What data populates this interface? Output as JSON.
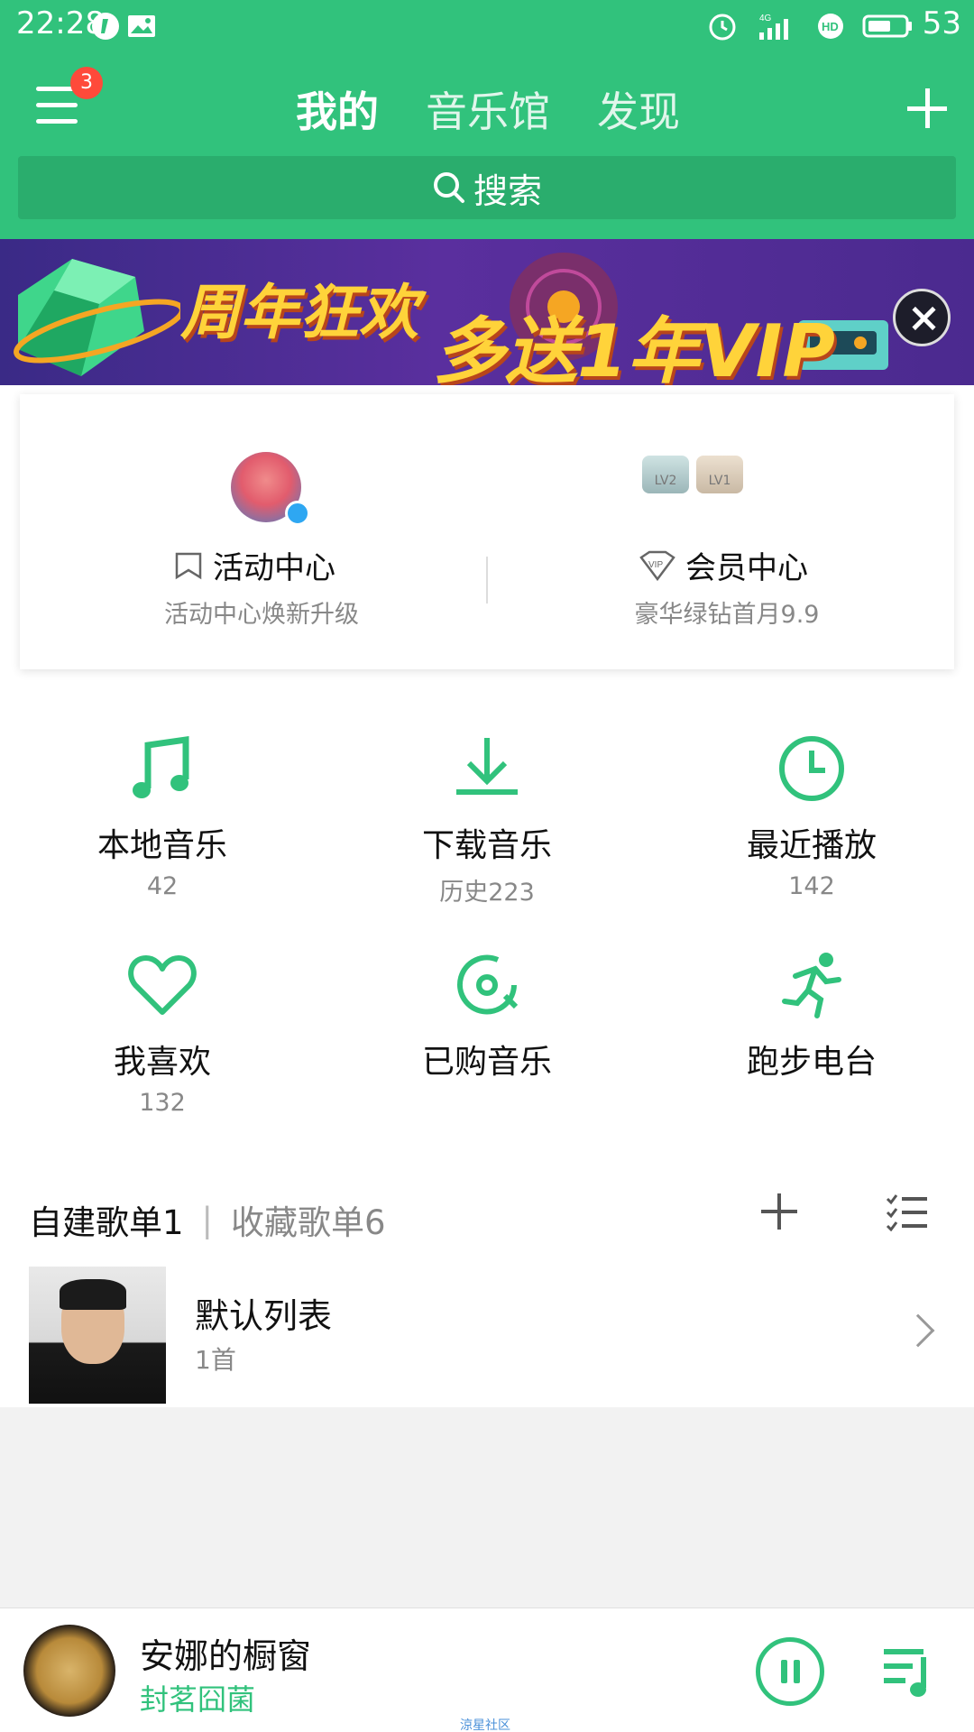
{
  "status": {
    "time": "22:28",
    "battery": "53",
    "icons": [
      "music-app-icon",
      "image-icon",
      "alarm-icon",
      "4g-signal-icon",
      "hd-icon",
      "battery-icon"
    ]
  },
  "header": {
    "menu_badge": "3",
    "tabs": [
      {
        "label": "我的",
        "active": true
      },
      {
        "label": "音乐馆",
        "active": false
      },
      {
        "label": "发现",
        "active": false
      }
    ],
    "search_label": "搜索"
  },
  "banner": {
    "line1": "周年狂欢",
    "line2": "多送1年VIP"
  },
  "card": {
    "left": {
      "title": "活动中心",
      "subtitle": "活动中心焕新升级"
    },
    "right": {
      "title": "会员中心",
      "subtitle": "豪华绿钻首月9.9"
    },
    "levels": [
      "LV2",
      "LV1"
    ]
  },
  "grid": [
    {
      "label": "本地音乐",
      "count": "42",
      "icon": "music-note-icon"
    },
    {
      "label": "下载音乐",
      "count": "历史223",
      "icon": "download-icon"
    },
    {
      "label": "最近播放",
      "count": "142",
      "icon": "clock-icon"
    },
    {
      "label": "我喜欢",
      "count": "132",
      "icon": "heart-icon"
    },
    {
      "label": "已购音乐",
      "count": "",
      "icon": "disc-icon"
    },
    {
      "label": "跑步电台",
      "count": "",
      "icon": "running-icon"
    }
  ],
  "playlists": {
    "created_label": "自建歌单1",
    "collected_label": "收藏歌单6",
    "items": [
      {
        "name": "默认列表",
        "count": "1首"
      }
    ]
  },
  "player": {
    "title": "安娜的橱窗",
    "artist": "封茗囧菌"
  },
  "watermark": "涼星社区",
  "colors": {
    "accent": "#31c27c",
    "badge": "#ff4a3a"
  }
}
